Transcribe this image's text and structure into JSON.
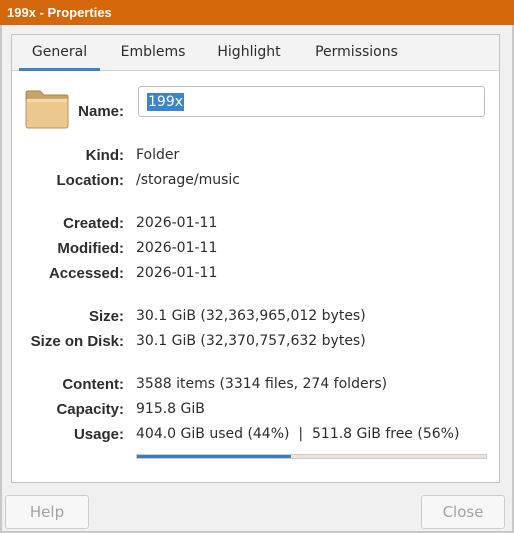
{
  "window": {
    "title": "199x - Properties"
  },
  "tabs": [
    {
      "label": "General",
      "active": true
    },
    {
      "label": "Emblems",
      "active": false
    },
    {
      "label": "Highlight",
      "active": false
    },
    {
      "label": "Permissions",
      "active": false
    }
  ],
  "name": {
    "label": "Name:",
    "value": "199x"
  },
  "info": {
    "kind": {
      "label": "Kind:",
      "value": "Folder"
    },
    "location": {
      "label": "Location:",
      "value": "/storage/music"
    },
    "created": {
      "label": "Created:",
      "value": "2026-01-11"
    },
    "modified": {
      "label": "Modified:",
      "value": "2026-01-11"
    },
    "accessed": {
      "label": "Accessed:",
      "value": "2026-01-11"
    },
    "size": {
      "label": "Size:",
      "value": "30.1 GiB (32,363,965,012 bytes)"
    },
    "size_on_disk": {
      "label": "Size on Disk:",
      "value": "30.1 GiB (32,370,757,632 bytes)"
    },
    "content": {
      "label": "Content:",
      "value": "3588 items (3314 files, 274 folders)"
    },
    "capacity": {
      "label": "Capacity:",
      "value": "915.8 GiB"
    },
    "usage": {
      "label": "Usage:",
      "value": "404.0 GiB used (44%)  |  511.8 GiB free (56%)",
      "used_fraction": 0.44
    }
  },
  "buttons": {
    "help": "Help",
    "close": "Close"
  },
  "colors": {
    "titlebar": "#d4670c",
    "accent": "#3c84c6"
  },
  "icons": {
    "folder": "folder-icon"
  }
}
